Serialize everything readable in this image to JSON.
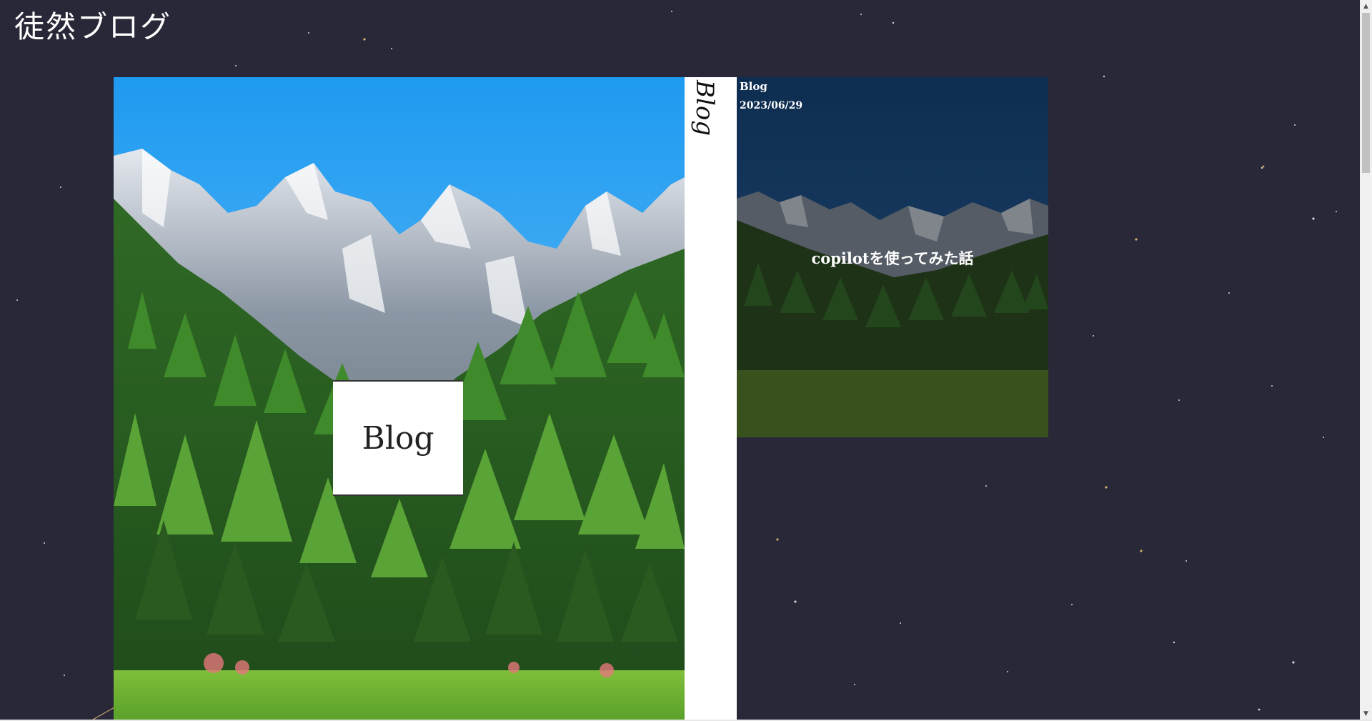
{
  "site": {
    "title": "徒然ブログ"
  },
  "hero": {
    "card_label": "Blog",
    "side_label": "Blog"
  },
  "post": {
    "category": "Blog",
    "date": "2023/06/29",
    "title": "copilotを使ってみた話"
  },
  "colors": {
    "background": "#282838",
    "sky": "#3aaef0",
    "forest": "#2f6a25",
    "card": "#ffffff"
  },
  "scrollbar": {
    "up_icon": "triangle-up",
    "down_icon": "triangle-down"
  }
}
